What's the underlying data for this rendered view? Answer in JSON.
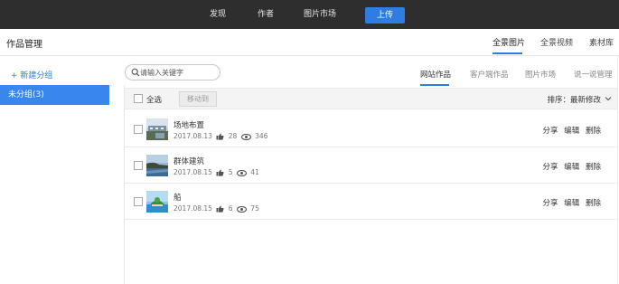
{
  "topnav": {
    "items": [
      "发现",
      "作者",
      "图片市场"
    ],
    "upload_label": "上传"
  },
  "page": {
    "title": "作品管理"
  },
  "top_tabs": [
    {
      "label": "全景图片",
      "active": true
    },
    {
      "label": "全景视频",
      "active": false
    },
    {
      "label": "素材库",
      "active": false
    }
  ],
  "sidebar": {
    "new_group_label": "+ 新建分组",
    "groups": [
      {
        "label": "未分组(3)",
        "active": true
      }
    ]
  },
  "search": {
    "placeholder": "请输入关键字",
    "value": ""
  },
  "sub_tabs": [
    {
      "label": "网站作品",
      "active": true
    },
    {
      "label": "客户端作品",
      "active": false
    },
    {
      "label": "图片市场",
      "active": false
    },
    {
      "label": "说一说管理",
      "active": false
    }
  ],
  "toolbar": {
    "select_all_label": "全选",
    "move_label": "移动到",
    "sort_label": "排序：最新修改"
  },
  "items": [
    {
      "title": "场地布置",
      "date": "2017.08.13",
      "likes": "28",
      "views": "346",
      "thumb": "building"
    },
    {
      "title": "群体建筑",
      "date": "2017.08.15",
      "likes": "5",
      "views": "41",
      "thumb": "coast"
    },
    {
      "title": "船",
      "date": "2017.08.15",
      "likes": "6",
      "views": "75",
      "thumb": "island"
    }
  ],
  "row_actions": {
    "share": "分享",
    "edit": "编辑",
    "delete": "删除"
  },
  "colors": {
    "accent": "#2f7de1",
    "topbar": "#2e2e2e",
    "sidebar_active": "#3a86ef"
  },
  "icons": {
    "search": "search-icon",
    "like": "thumbs-up-icon",
    "view": "eye-icon",
    "sort": "chevron-down-icon"
  }
}
